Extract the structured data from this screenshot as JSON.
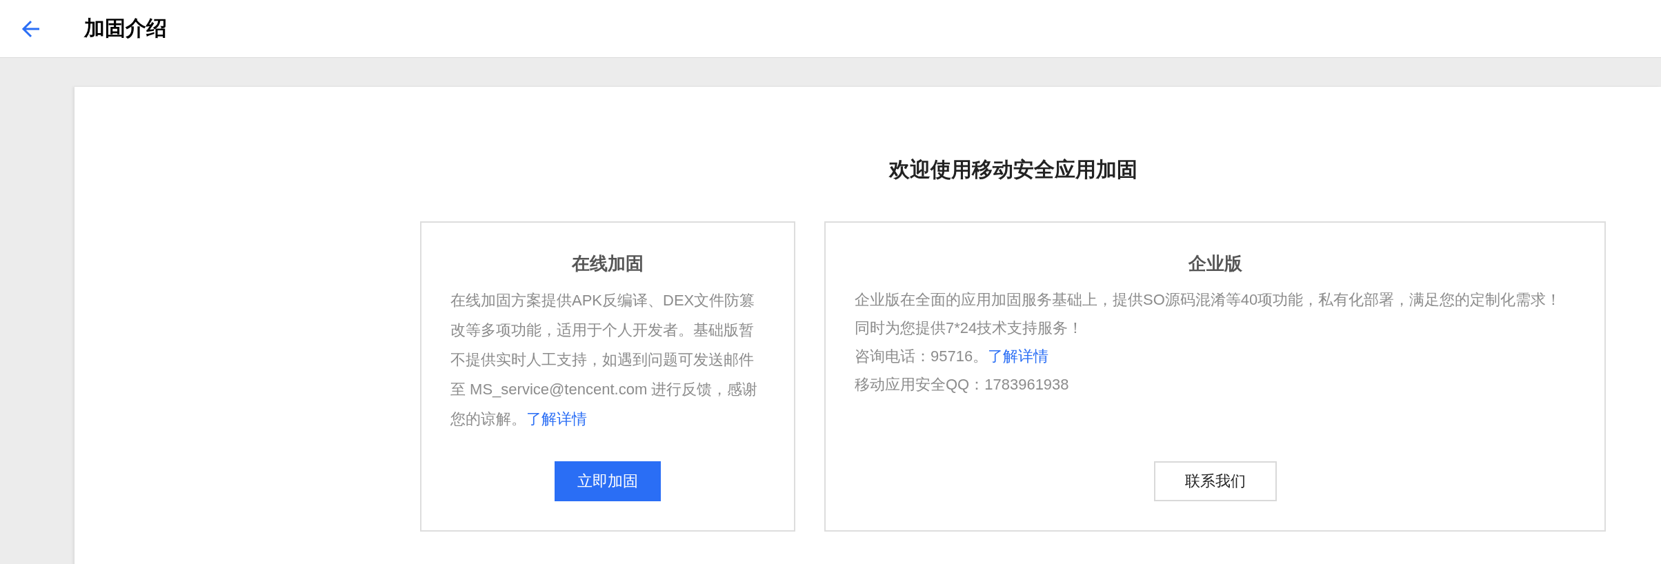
{
  "header": {
    "title": "加固介绍"
  },
  "main": {
    "heading": "欢迎使用移动安全应用加固",
    "cards": [
      {
        "title": "在线加固",
        "paragraphs": [
          {
            "text": "在线加固方案提供APK反编译、DEX文件防篡改等多项功能，适用于个人开发者。基础版暂不提供实时人工支持，如遇到问题可发送邮件至 MS_service@tencent.com 进行反馈，感谢您的谅解。",
            "link": "了解详情"
          }
        ],
        "button": {
          "label": "立即加固",
          "kind": "primary"
        }
      },
      {
        "title": "企业版",
        "paragraphs": [
          {
            "text": "企业版在全面的应用加固服务基础上，提供SO源码混淆等40项功能，私有化部署，满足您的定制化需求！同时为您提供7*24技术支持服务！"
          },
          {
            "text": "咨询电话：95716。",
            "link": "了解详情"
          },
          {
            "text": "移动应用安全QQ：1783961938"
          }
        ],
        "button": {
          "label": "联系我们",
          "kind": "outline"
        }
      }
    ]
  }
}
